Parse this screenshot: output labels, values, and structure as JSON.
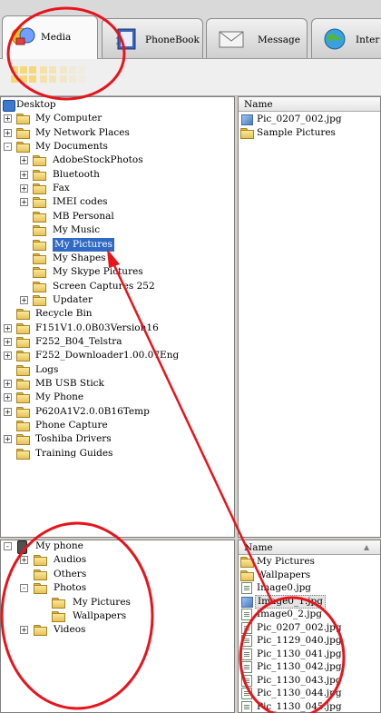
{
  "tabs": [
    {
      "label": "Media",
      "icon": "media-icon"
    },
    {
      "label": "PhoneBook",
      "icon": "phonebook-icon"
    },
    {
      "label": "Message",
      "icon": "message-icon"
    },
    {
      "label": "Inter",
      "icon": "internet-icon"
    }
  ],
  "pc_tree": {
    "root": "Desktop",
    "items": [
      {
        "label": "My Computer",
        "level": 1,
        "expander": "+",
        "icon": "computer-icon"
      },
      {
        "label": "My Network Places",
        "level": 1,
        "expander": "+",
        "icon": "network-icon"
      },
      {
        "label": "My Documents",
        "level": 1,
        "expander": "-",
        "icon": "folder-icon"
      },
      {
        "label": "AdobeStockPhotos",
        "level": 2,
        "expander": "+",
        "icon": "folder-icon"
      },
      {
        "label": "Bluetooth",
        "level": 2,
        "expander": "+",
        "icon": "folder-icon"
      },
      {
        "label": "Fax",
        "level": 2,
        "expander": "+",
        "icon": "folder-icon"
      },
      {
        "label": "IMEI codes",
        "level": 2,
        "expander": "+",
        "icon": "folder-icon"
      },
      {
        "label": "MB Personal",
        "level": 2,
        "expander": "",
        "icon": "folder-icon"
      },
      {
        "label": "My Music",
        "level": 2,
        "expander": "",
        "icon": "music-folder-icon"
      },
      {
        "label": "My Pictures",
        "level": 2,
        "expander": "",
        "icon": "pictures-folder-icon",
        "selected": true
      },
      {
        "label": "My Shapes",
        "level": 2,
        "expander": "",
        "icon": "shapes-folder-icon"
      },
      {
        "label": "My Skype Pictures",
        "level": 2,
        "expander": "",
        "icon": "folder-icon"
      },
      {
        "label": "Screen Captures 252",
        "level": 2,
        "expander": "",
        "icon": "folder-icon"
      },
      {
        "label": "Updater",
        "level": 2,
        "expander": "+",
        "icon": "folder-icon"
      },
      {
        "label": "Recycle Bin",
        "level": 1,
        "expander": "",
        "icon": "recycle-bin-icon"
      },
      {
        "label": "F151V1.0.0B03Version16",
        "level": 1,
        "expander": "+",
        "icon": "folder-icon"
      },
      {
        "label": "F252_B04_Telstra",
        "level": 1,
        "expander": "+",
        "icon": "folder-icon"
      },
      {
        "label": "F252_Downloader1.00.07Eng",
        "level": 1,
        "expander": "+",
        "icon": "folder-icon"
      },
      {
        "label": "Logs",
        "level": 1,
        "expander": "",
        "icon": "folder-icon"
      },
      {
        "label": "MB USB Stick",
        "level": 1,
        "expander": "+",
        "icon": "folder-icon"
      },
      {
        "label": "My Phone",
        "level": 1,
        "expander": "+",
        "icon": "folder-icon"
      },
      {
        "label": "P620A1V2.0.0B16Temp",
        "level": 1,
        "expander": "+",
        "icon": "folder-icon"
      },
      {
        "label": "Phone Capture",
        "level": 1,
        "expander": "",
        "icon": "folder-icon"
      },
      {
        "label": "Toshiba Drivers",
        "level": 1,
        "expander": "+",
        "icon": "folder-icon"
      },
      {
        "label": "Training Guides",
        "level": 1,
        "expander": "",
        "icon": "folder-icon"
      }
    ]
  },
  "pc_list": {
    "header": "Name",
    "items": [
      {
        "label": "Pic_0207_002.jpg",
        "icon": "image-file-icon"
      },
      {
        "label": "Sample Pictures",
        "icon": "folder-icon"
      }
    ]
  },
  "phone_tree": {
    "root": "My phone",
    "items": [
      {
        "label": "Audios",
        "level": 1,
        "expander": "+"
      },
      {
        "label": "Others",
        "level": 1,
        "expander": ""
      },
      {
        "label": "Photos",
        "level": 1,
        "expander": "-"
      },
      {
        "label": "My Pictures",
        "level": 2,
        "expander": ""
      },
      {
        "label": "Wallpapers",
        "level": 2,
        "expander": ""
      },
      {
        "label": "Videos",
        "level": 1,
        "expander": "+"
      }
    ]
  },
  "phone_list": {
    "header": "Name",
    "items": [
      {
        "label": "My Pictures",
        "icon": "folder-icon"
      },
      {
        "label": "Wallpapers",
        "icon": "folder-icon"
      },
      {
        "label": "Image0.jpg",
        "icon": "file-icon"
      },
      {
        "label": "Image0_1.jpg",
        "icon": "image-file-icon",
        "selected": true
      },
      {
        "label": "Image0_2.jpg",
        "icon": "file-icon"
      },
      {
        "label": "Pic_0207_002.jpg",
        "icon": "file-icon"
      },
      {
        "label": "Pic_1129_040.jpg",
        "icon": "file-icon"
      },
      {
        "label": "Pic_1130_041.jpg",
        "icon": "file-icon"
      },
      {
        "label": "Pic_1130_042.jpg",
        "icon": "file-icon"
      },
      {
        "label": "Pic_1130_043.jpg",
        "icon": "file-icon"
      },
      {
        "label": "Pic_1130_044.jpg",
        "icon": "file-icon"
      },
      {
        "label": "Pic_1130_045.jpg",
        "icon": "file-icon"
      }
    ]
  },
  "colors": {
    "annotation": "#e8141c",
    "selection": "#316ac5"
  }
}
